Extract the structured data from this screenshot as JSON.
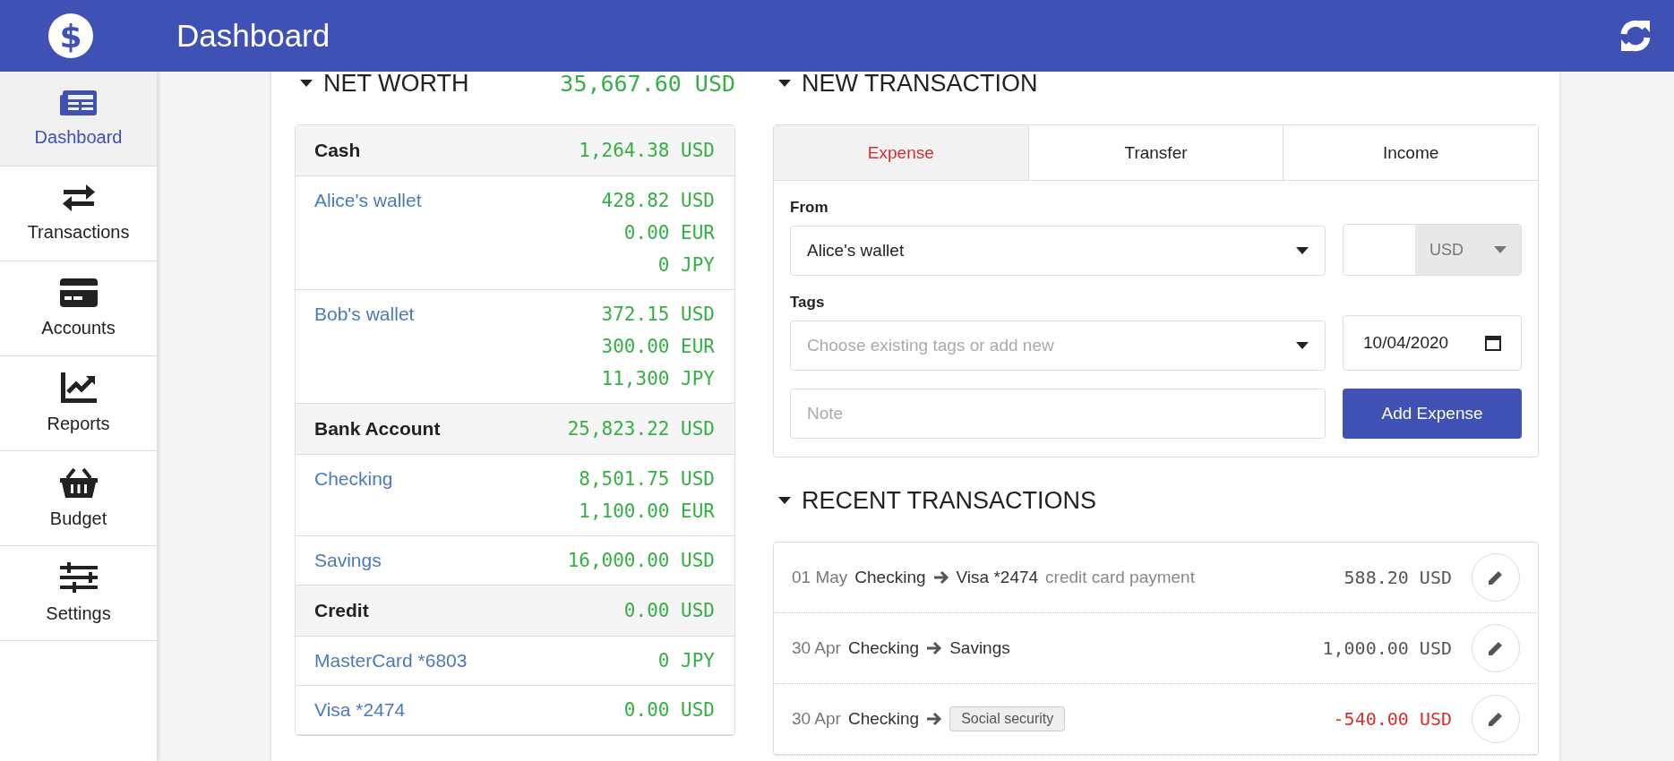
{
  "app": {
    "logo_symbol": "$",
    "title": "Dashboard"
  },
  "sidebar": {
    "items": [
      {
        "label": "Dashboard",
        "selected": true
      },
      {
        "label": "Transactions",
        "selected": false
      },
      {
        "label": "Accounts",
        "selected": false
      },
      {
        "label": "Reports",
        "selected": false
      },
      {
        "label": "Budget",
        "selected": false
      },
      {
        "label": "Settings",
        "selected": false
      }
    ]
  },
  "net_worth": {
    "title": "NET WORTH",
    "total": "35,667.60 USD",
    "groups": [
      {
        "name": "Cash",
        "total": "1,264.38 USD",
        "accounts": [
          {
            "name": "Alice's wallet",
            "balances": [
              "428.82 USD",
              "0.00 EUR",
              "0 JPY"
            ]
          },
          {
            "name": "Bob's wallet",
            "balances": [
              "372.15 USD",
              "300.00 EUR",
              "11,300 JPY"
            ]
          }
        ]
      },
      {
        "name": "Bank Account",
        "total": "25,823.22 USD",
        "accounts": [
          {
            "name": "Checking",
            "balances": [
              "8,501.75 USD",
              "1,100.00 EUR"
            ]
          },
          {
            "name": "Savings",
            "balances": [
              "16,000.00 USD"
            ]
          }
        ]
      },
      {
        "name": "Credit",
        "total": "0.00 USD",
        "accounts": [
          {
            "name": "MasterCard *6803",
            "balances": [
              "0 JPY"
            ]
          },
          {
            "name": "Visa *2474",
            "balances": [
              "0.00 USD"
            ]
          }
        ]
      }
    ]
  },
  "new_transaction": {
    "title": "NEW TRANSACTION",
    "tabs": [
      {
        "label": "Expense",
        "selected": true
      },
      {
        "label": "Transfer",
        "selected": false
      },
      {
        "label": "Income",
        "selected": false
      }
    ],
    "from_label": "From",
    "from_value": "Alice's wallet",
    "currency": "USD",
    "tags_label": "Tags",
    "tags_placeholder": "Choose existing tags or add new",
    "date": "10/04/2020",
    "note_placeholder": "Note",
    "submit_label": "Add Expense"
  },
  "recent_transactions": {
    "title": "RECENT TRANSACTIONS",
    "rows": [
      {
        "kind": "transfer",
        "date": "01 May",
        "from": "Checking",
        "to": "Visa *2474",
        "note": "credit card payment",
        "amount": "588.20 USD"
      },
      {
        "kind": "transfer",
        "date": "30 Apr",
        "from": "Checking",
        "to": "Savings",
        "amount": "1,000.00 USD"
      },
      {
        "kind": "expense",
        "date": "30 Apr",
        "from": "Checking",
        "tags": [
          "Social security"
        ],
        "amount": "-540.00 USD"
      }
    ]
  }
}
